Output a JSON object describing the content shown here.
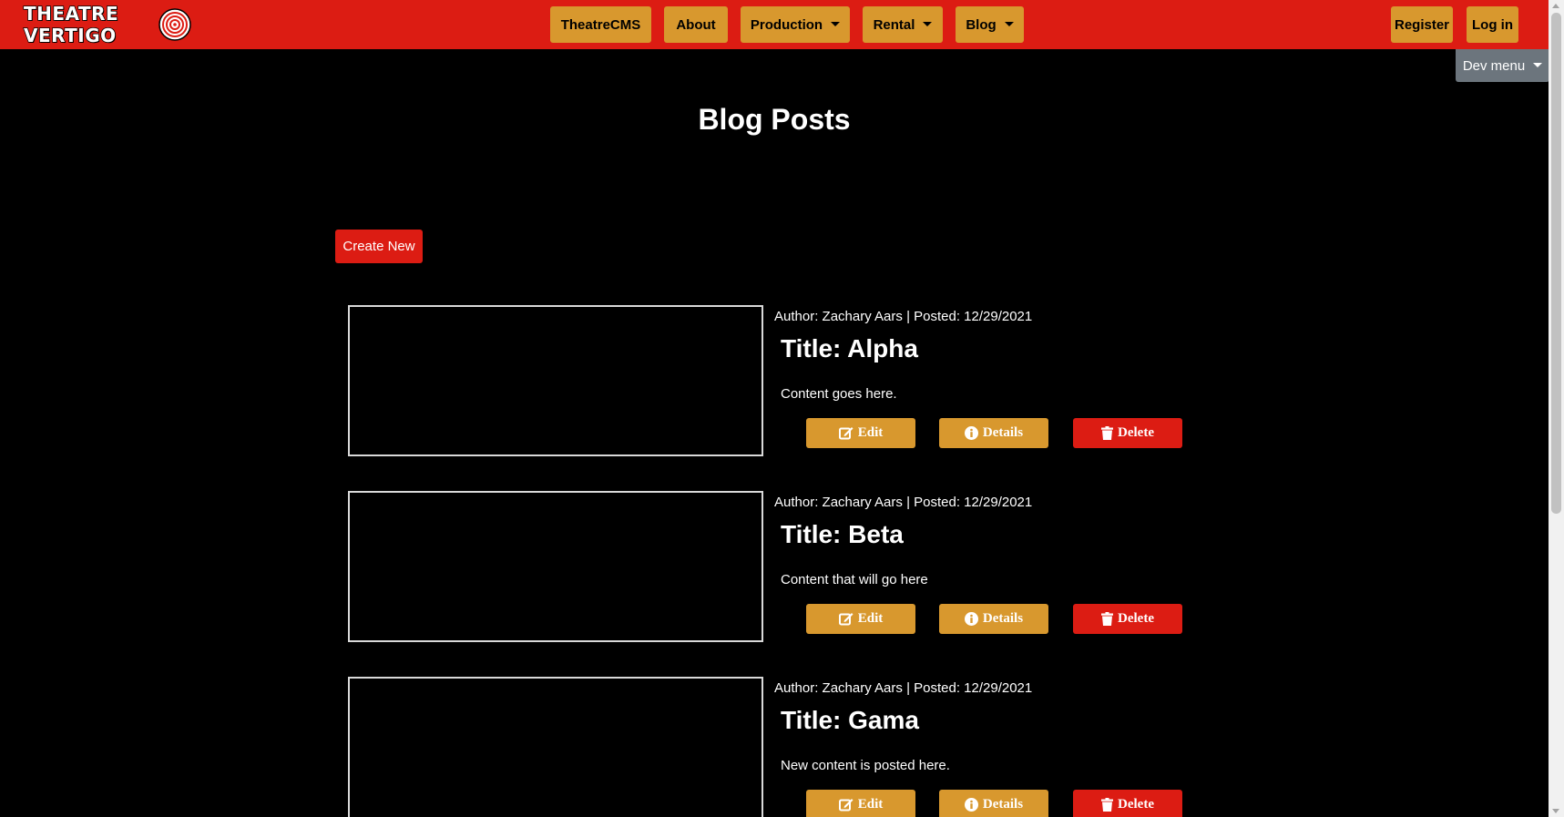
{
  "brand": {
    "logo_text": "THEATRE VERTIGO"
  },
  "nav": {
    "items": [
      {
        "label": "TheatreCMS",
        "dropdown": false
      },
      {
        "label": "About",
        "dropdown": false
      },
      {
        "label": "Production",
        "dropdown": true
      },
      {
        "label": "Rental",
        "dropdown": true
      },
      {
        "label": "Blog",
        "dropdown": true
      }
    ],
    "register_label": "Register",
    "login_label": "Log in"
  },
  "dev_menu": {
    "label": "Dev menu"
  },
  "main": {
    "page_title": "Blog Posts",
    "create_label": "Create New",
    "posts": [
      {
        "meta": "Author: Zachary Aars | Posted: 12/29/2021",
        "title": "Title: Alpha",
        "content": "Content goes here."
      },
      {
        "meta": "Author: Zachary Aars | Posted: 12/29/2021",
        "title": "Title: Beta",
        "content": "Content that will go here"
      },
      {
        "meta": "Author: Zachary Aars | Posted: 12/29/2021",
        "title": "Title: Gama",
        "content": "New content is posted here."
      }
    ],
    "actions": {
      "edit": "Edit",
      "details": "Details",
      "delete": "Delete"
    }
  },
  "icons": {
    "edit": "edit-icon",
    "details": "info-circle-icon",
    "delete": "trash-icon",
    "caret": "caret-down-icon"
  },
  "colors": {
    "navbar": "#dc1c13",
    "accent": "#d8982e",
    "danger": "#dc1c13",
    "dev_menu": "#6c757d",
    "background": "#000000"
  }
}
